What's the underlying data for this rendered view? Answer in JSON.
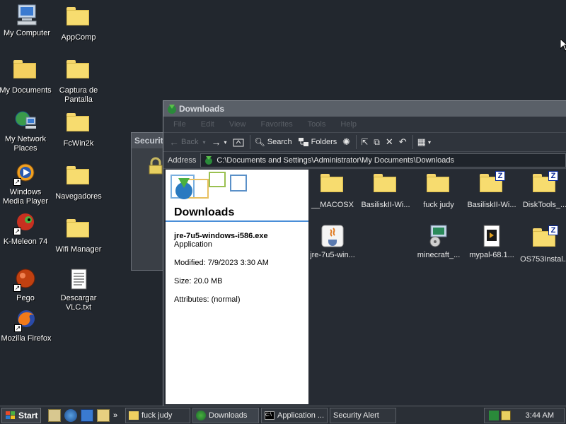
{
  "desktop": {
    "icons": [
      {
        "label": "My Computer"
      },
      {
        "label": "AppComp"
      },
      {
        "label": "My Documents"
      },
      {
        "label": "Captura de Pantalla"
      },
      {
        "label": "My Network Places"
      },
      {
        "label": "FcWin2k"
      },
      {
        "label": "Windows Media Player"
      },
      {
        "label": "Navegadores"
      },
      {
        "label": "K-Meleon 74"
      },
      {
        "label": "Wifi Manager"
      },
      {
        "label": "Pego"
      },
      {
        "label": "Descargar VLC.txt"
      },
      {
        "label": "Mozilla Firefox"
      }
    ]
  },
  "security_window": {
    "title": "Securit"
  },
  "explorer": {
    "title": "Downloads",
    "menu": [
      "File",
      "Edit",
      "View",
      "Favorites",
      "Tools",
      "Help"
    ],
    "toolbar": {
      "back": "Back",
      "search": "Search",
      "folders": "Folders"
    },
    "address_label": "Address",
    "address_path": "C:\\Documents and Settings\\Administrator\\My Documents\\Downloads",
    "taskpane": {
      "title": "Downloads",
      "file_name": "jre-7u5-windows-i586.exe",
      "file_type": "Application",
      "modified": "Modified: 7/9/2023 3:30 AM",
      "size": "Size: 20.0 MB",
      "attributes": "Attributes: (normal)"
    },
    "files": [
      {
        "name": "__MACOSX"
      },
      {
        "name": "BasiliskII-Wi..."
      },
      {
        "name": "fuck judy"
      },
      {
        "name": "BasiliskII-Wi..."
      },
      {
        "name": "DiskTools_..."
      },
      {
        "name": "jre-7u5-win..."
      },
      {
        "name": "minecraft_..."
      },
      {
        "name": "mypal-68.1..."
      },
      {
        "name": "OS753Instal..."
      }
    ]
  },
  "taskbar": {
    "start": "Start",
    "tasks": [
      {
        "label": "fuck judy"
      },
      {
        "label": "Downloads"
      },
      {
        "label": "Application ..."
      },
      {
        "label": "Security Alert"
      }
    ],
    "clock": "3:44 AM"
  },
  "colors": {
    "folder": "#f7dc6f",
    "accent": "#4a8ed8",
    "desktop": "#22272e"
  }
}
